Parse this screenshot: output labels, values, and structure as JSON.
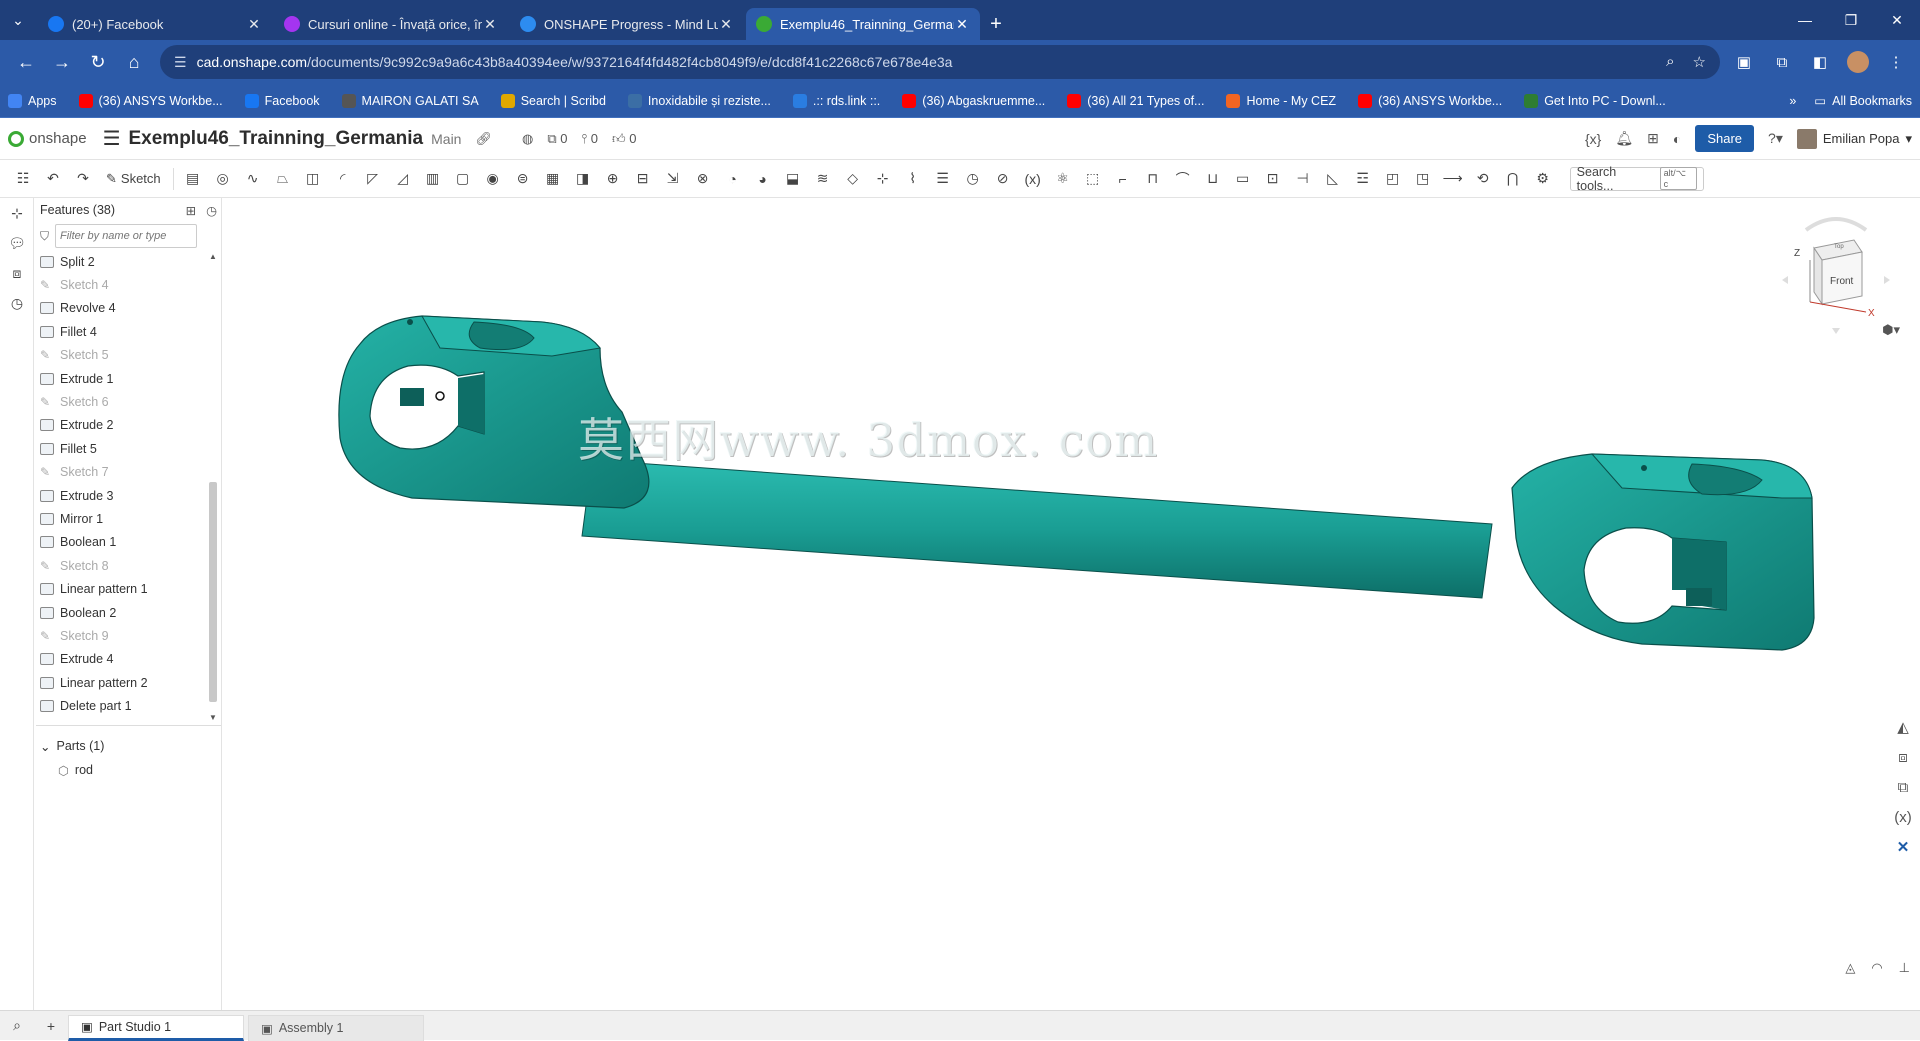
{
  "browser": {
    "tabs": [
      {
        "title": "(20+) Facebook",
        "favicon": "facebook-icon",
        "color": "#1877f2"
      },
      {
        "title": "Cursuri online - Învață orice, în",
        "favicon": "udemy-icon",
        "color": "#a435f0"
      },
      {
        "title": "ONSHAPE Progress - Mind Lust",
        "favicon": "mindlust-icon",
        "color": "#2d8cf0"
      },
      {
        "title": "Exemplu46_Trainning_Germania",
        "favicon": "onshape-icon",
        "color": "#3aaa35"
      }
    ],
    "url_host": "cad.onshape.com",
    "url_path": "/documents/9c992c9a9a6c43b8a40394ee/w/9372164f4fd482f4cb8049f9/e/dcd8f41c2268c67e678e4e3a",
    "bookmarks": [
      {
        "label": "Apps",
        "icon": "apps-grid-icon",
        "color": "#4285f4"
      },
      {
        "label": "(36) ANSYS Workbe...",
        "icon": "youtube-icon",
        "color": "#ff0000"
      },
      {
        "label": "Facebook",
        "icon": "facebook-icon",
        "color": "#1877f2"
      },
      {
        "label": "MAIRON GALATI SA",
        "icon": "globe-icon",
        "color": "#555555"
      },
      {
        "label": "Search | Scribd",
        "icon": "scribd-icon",
        "color": "#e0a800"
      },
      {
        "label": "Inoxidabile și reziste...",
        "icon": "store-icon",
        "color": "#3b6ea5"
      },
      {
        "label": ".:: rds.link ::.",
        "icon": "rds-icon",
        "color": "#2a7de1"
      },
      {
        "label": "(36) Abgaskruemme...",
        "icon": "youtube-icon",
        "color": "#ff0000"
      },
      {
        "label": "(36) All 21 Types of...",
        "icon": "youtube-icon",
        "color": "#ff0000"
      },
      {
        "label": "Home - My CEZ",
        "icon": "cez-icon",
        "color": "#f26522"
      },
      {
        "label": "(36) ANSYS Workbe...",
        "icon": "youtube-icon",
        "color": "#ff0000"
      },
      {
        "label": "Get Into PC - Downl...",
        "icon": "getintopc-icon",
        "color": "#2e7d32"
      }
    ],
    "all_bookmarks": "All Bookmarks"
  },
  "app": {
    "logo": "onshape",
    "doc_title": "Exemplu46_Trainning_Germania",
    "branch": "Main",
    "counts": {
      "versions": "0",
      "branches": "0",
      "likes": "0"
    },
    "share": "Share",
    "user": "Emilian Popa"
  },
  "toolbar": {
    "sketch": "Sketch",
    "search_tools": "Search tools...",
    "search_kbd": "alt/⌥ c"
  },
  "features": {
    "header": "Features (38)",
    "filter_placeholder": "Filter by name or type",
    "items": [
      {
        "label": "Split 2",
        "type": "op"
      },
      {
        "label": "Sketch 4",
        "type": "sketch"
      },
      {
        "label": "Revolve 4",
        "type": "op"
      },
      {
        "label": "Fillet 4",
        "type": "op"
      },
      {
        "label": "Sketch 5",
        "type": "sketch"
      },
      {
        "label": "Extrude 1",
        "type": "op"
      },
      {
        "label": "Sketch 6",
        "type": "sketch"
      },
      {
        "label": "Extrude 2",
        "type": "op"
      },
      {
        "label": "Fillet 5",
        "type": "op"
      },
      {
        "label": "Sketch 7",
        "type": "sketch"
      },
      {
        "label": "Extrude 3",
        "type": "op"
      },
      {
        "label": "Mirror 1",
        "type": "op"
      },
      {
        "label": "Boolean 1",
        "type": "op"
      },
      {
        "label": "Sketch 8",
        "type": "sketch"
      },
      {
        "label": "Linear pattern 1",
        "type": "op"
      },
      {
        "label": "Boolean 2",
        "type": "op"
      },
      {
        "label": "Sketch 9",
        "type": "sketch"
      },
      {
        "label": "Extrude 4",
        "type": "op"
      },
      {
        "label": "Linear pattern 2",
        "type": "op"
      },
      {
        "label": "Delete part 1",
        "type": "op"
      }
    ],
    "parts_header": "Parts (1)",
    "parts": [
      "rod"
    ]
  },
  "viewport": {
    "part_color": "#1a9e94",
    "watermark": "莫西网www. 3dmox. com",
    "navcube": {
      "front": "Front",
      "top": "Top",
      "axis_z": "Z",
      "axis_x": "X"
    }
  },
  "bottom_tabs": [
    {
      "label": "Part Studio 1",
      "active": true
    },
    {
      "label": "Assembly 1",
      "active": false
    }
  ]
}
